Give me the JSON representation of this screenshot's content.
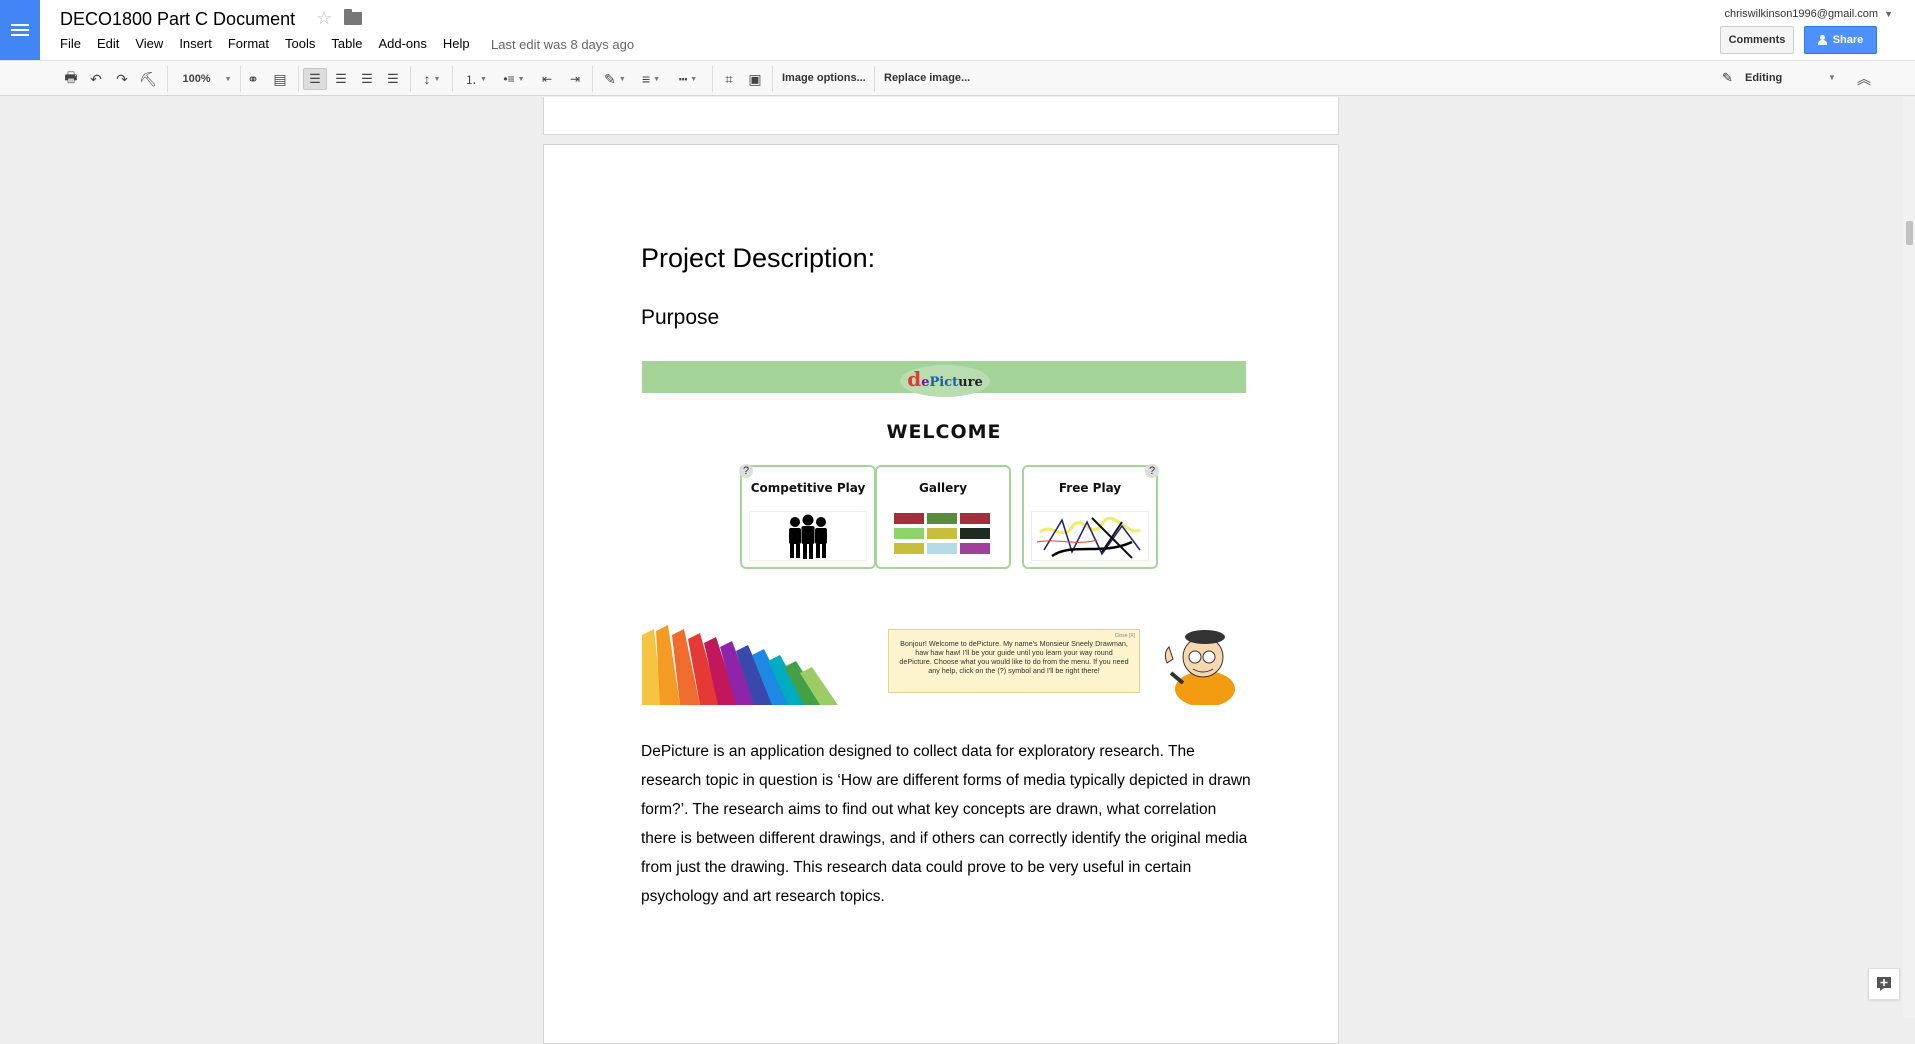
{
  "app": {
    "doc_title": "DECO1800 Part C Document",
    "account_email": "chriswilkinson1996@gmail.com",
    "last_edit": "Last edit was 8 days ago"
  },
  "menu": [
    "File",
    "Edit",
    "View",
    "Insert",
    "Format",
    "Tools",
    "Table",
    "Add-ons",
    "Help"
  ],
  "buttons": {
    "comments": "Comments",
    "share": "Share"
  },
  "toolbar": {
    "zoom": "100%",
    "image_options": "Image options...",
    "replace_image": "Replace image...",
    "mode": "Editing"
  },
  "document": {
    "heading": "Project Description:",
    "subheading": "Purpose",
    "body": "DePicture is an application designed to collect data for exploratory research. The research topic in question is ‘How are different forms of media typically depicted in drawn form?’. The research aims to find out what key concepts are drawn, what correlation there is between different drawings, and if others can correctly identify the original media from just the drawing. This research data could prove to be very useful in certain psychology and art research topics."
  },
  "embedded_image": {
    "logo_letters": [
      "d",
      "e",
      "Pict",
      "ure"
    ],
    "welcome": "WELCOME",
    "cards": [
      "Competitive Play",
      "Gallery",
      "Free Play"
    ],
    "help_mark": "?",
    "speech": "Bonjour! Welcome to dePicture. My name's Monsieur Sneely Drawman, haw haw haw! I'll be your guide until you learn your way round dePicture. Choose what you would like to do from the menu. If you need any help, click on the (?) symbol and I'll be right there!",
    "speech_close": "Close [X]",
    "gallery_colors": [
      "#a0313a",
      "#5a8a3c",
      "#a0313a",
      "#8fd36b",
      "#c7be3b",
      "#1d2b22",
      "#c7be3b",
      "#b5dbe6",
      "#a03f9c"
    ]
  }
}
